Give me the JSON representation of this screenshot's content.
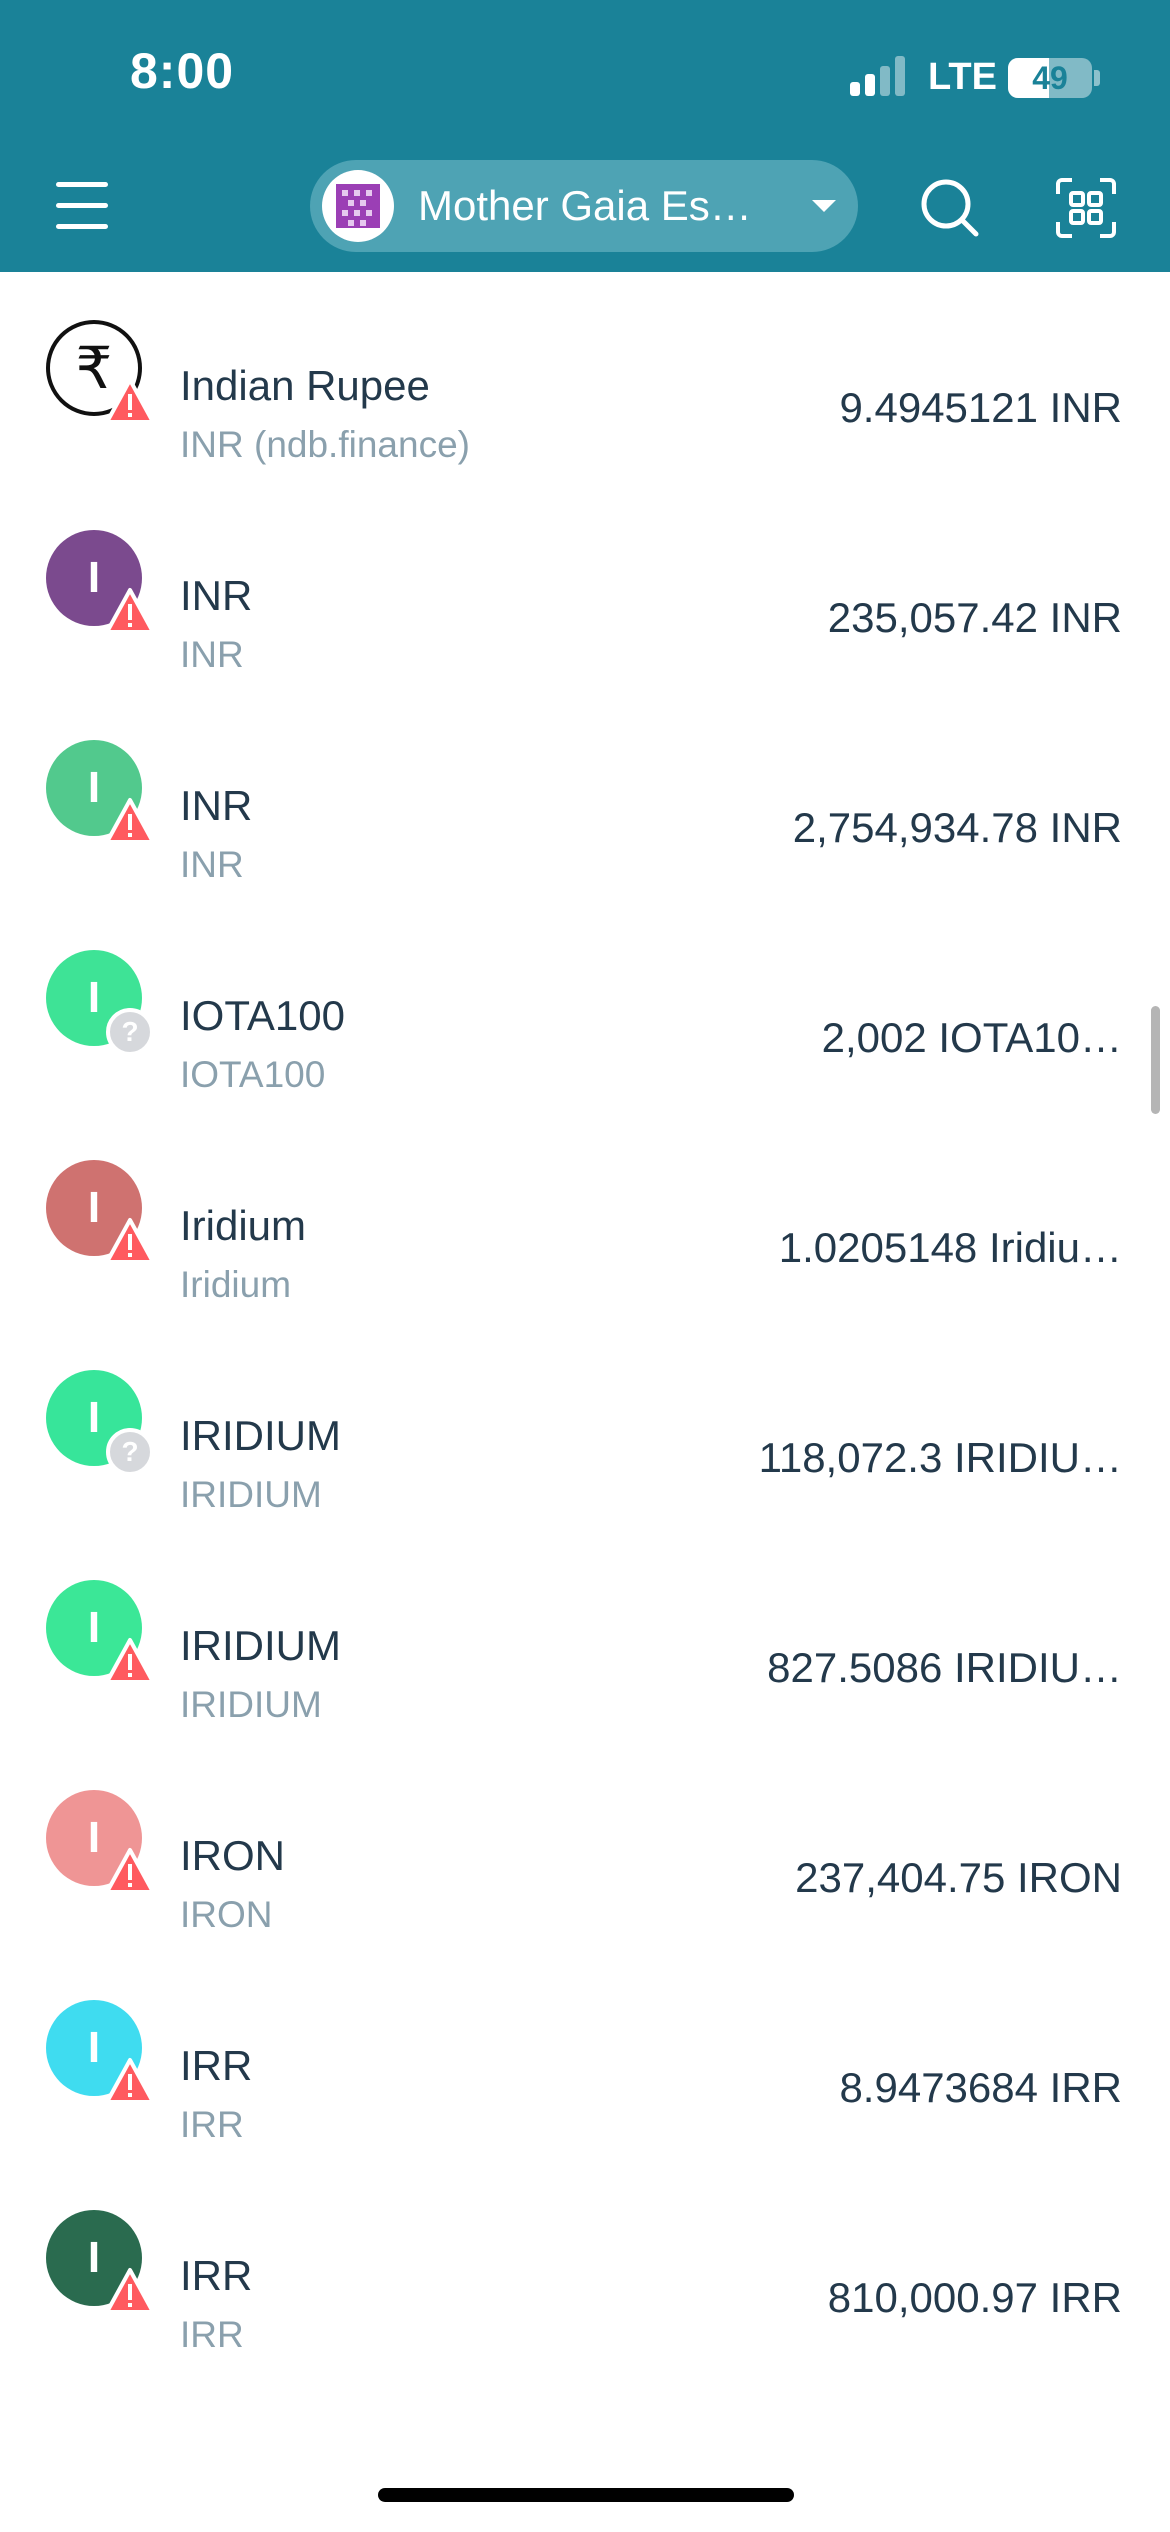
{
  "status_bar": {
    "time": "8:00",
    "network": "LTE",
    "battery_level": "49",
    "battery_percent": 49
  },
  "header": {
    "menu_icon": "hamburger-menu-icon",
    "wallet_name": "Mother Gaia Es…",
    "wallet_caret_icon": "caret-down-icon",
    "search_icon": "search-icon",
    "scan_icon": "qr-scan-icon",
    "background_color": "#1a8298",
    "pill_color": "#4ea3b4"
  },
  "assets": [
    {
      "name": "Indian Rupee",
      "code": "INR (ndb.finance)",
      "balance": "9.4945121 INR",
      "icon_letter": "₹",
      "icon_color": "#ffffff",
      "badge": "warning"
    },
    {
      "name": "INR",
      "code": "INR",
      "balance": "235,057.42 INR",
      "icon_letter": "I",
      "icon_color": "#7b4a8e",
      "badge": "warning"
    },
    {
      "name": "INR",
      "code": "INR",
      "balance": "2,754,934.78 INR",
      "icon_letter": "I",
      "icon_color": "#52c98d",
      "badge": "warning"
    },
    {
      "name": "IOTA100",
      "code": "IOTA100",
      "balance": "2,002 IOTA10…",
      "icon_letter": "I",
      "icon_color": "#3ee396",
      "badge": "unknown"
    },
    {
      "name": "Iridium",
      "code": "Iridium",
      "balance": "1.0205148 Iridiu…",
      "icon_letter": "I",
      "icon_color": "#cf7270",
      "badge": "warning"
    },
    {
      "name": "IRIDIUM",
      "code": "IRIDIUM",
      "balance": "118,072.3 IRIDIU…",
      "icon_letter": "I",
      "icon_color": "#37e59a",
      "badge": "unknown"
    },
    {
      "name": "IRIDIUM",
      "code": "IRIDIUM",
      "balance": "827.5086 IRIDIU…",
      "icon_letter": "I",
      "icon_color": "#3be797",
      "badge": "warning"
    },
    {
      "name": "IRON",
      "code": "IRON",
      "balance": "237,404.75 IRON",
      "icon_letter": "I",
      "icon_color": "#ef9595",
      "badge": "warning"
    },
    {
      "name": "IRR",
      "code": "IRR",
      "balance": "8.9473684 IRR",
      "icon_letter": "I",
      "icon_color": "#3fdcf0",
      "badge": "warning"
    },
    {
      "name": "IRR",
      "code": "IRR",
      "balance": "810,000.97 IRR",
      "icon_letter": "I",
      "icon_color": "#2a6b4f",
      "badge": "warning"
    }
  ]
}
